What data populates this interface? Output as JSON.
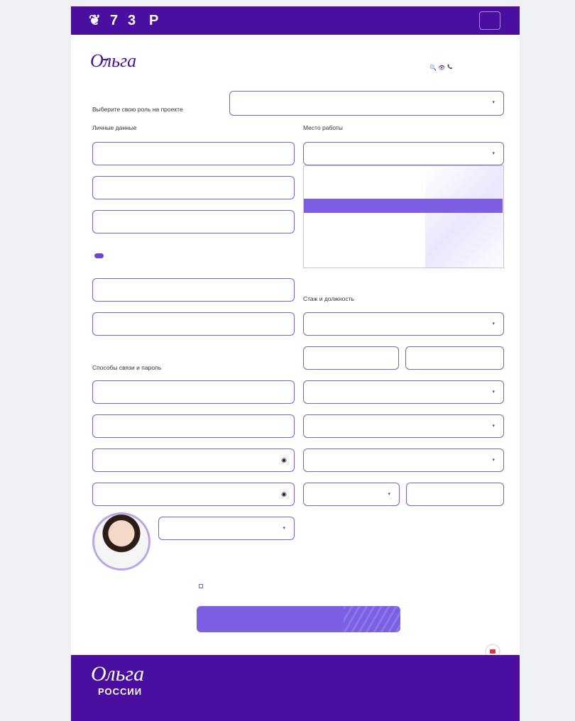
{
  "topbar": {
    "logos": [
      "❦",
      "7",
      "3",
      "P"
    ],
    "right_text": "",
    "badge_text": ""
  },
  "header": {
    "logo_script": "Ольга",
    "logo_box": "",
    "logo_russia": "",
    "icons": "🔍 👁",
    "phone": "📞"
  },
  "role": {
    "label": "Выберите свою роль на проекте",
    "placeholder": ""
  },
  "sections": {
    "personal": "Личные данные",
    "work": "Место работы",
    "experience": "Стаж и должность",
    "contacts": "Способы связи и пароль"
  },
  "personal_fields": [
    {
      "label": "",
      "value": ""
    },
    {
      "label": "",
      "value": ""
    },
    {
      "label": "",
      "value": ""
    }
  ],
  "work_fields": [
    {
      "label": "",
      "value": ""
    }
  ],
  "dropdown_options": [
    "",
    "",
    "",
    "",
    "",
    ""
  ],
  "gender_toggle": "",
  "date_fields": [
    {
      "label": "",
      "value": ""
    },
    {
      "label": "",
      "value": ""
    }
  ],
  "experience_fields": [
    {
      "label": "",
      "value": ""
    },
    {
      "label": "",
      "value": ""
    },
    {
      "label": "",
      "value": ""
    },
    {
      "label": "",
      "value": ""
    },
    {
      "label": "",
      "value": ""
    },
    {
      "label": "",
      "value": ""
    },
    {
      "label": "",
      "value": ""
    },
    {
      "label": "",
      "value": ""
    }
  ],
  "contact_fields": [
    {
      "label": "",
      "value": ""
    },
    {
      "label": "",
      "value": ""
    },
    {
      "label": "",
      "value": ""
    },
    {
      "label": "",
      "value": ""
    }
  ],
  "avatar_select": {
    "label": "",
    "value": ""
  },
  "consent": "",
  "submit_label": "",
  "footer": {
    "logo_script": "Ольга",
    "logo_russia": "РОССИИ",
    "copyright": "",
    "phone": "",
    "email": "",
    "social": "",
    "links": [
      "",
      "",
      "",
      "",
      ""
    ],
    "right_header": ""
  },
  "colors": {
    "brand": "#4a0fa0",
    "accent": "#7d5fe3"
  }
}
